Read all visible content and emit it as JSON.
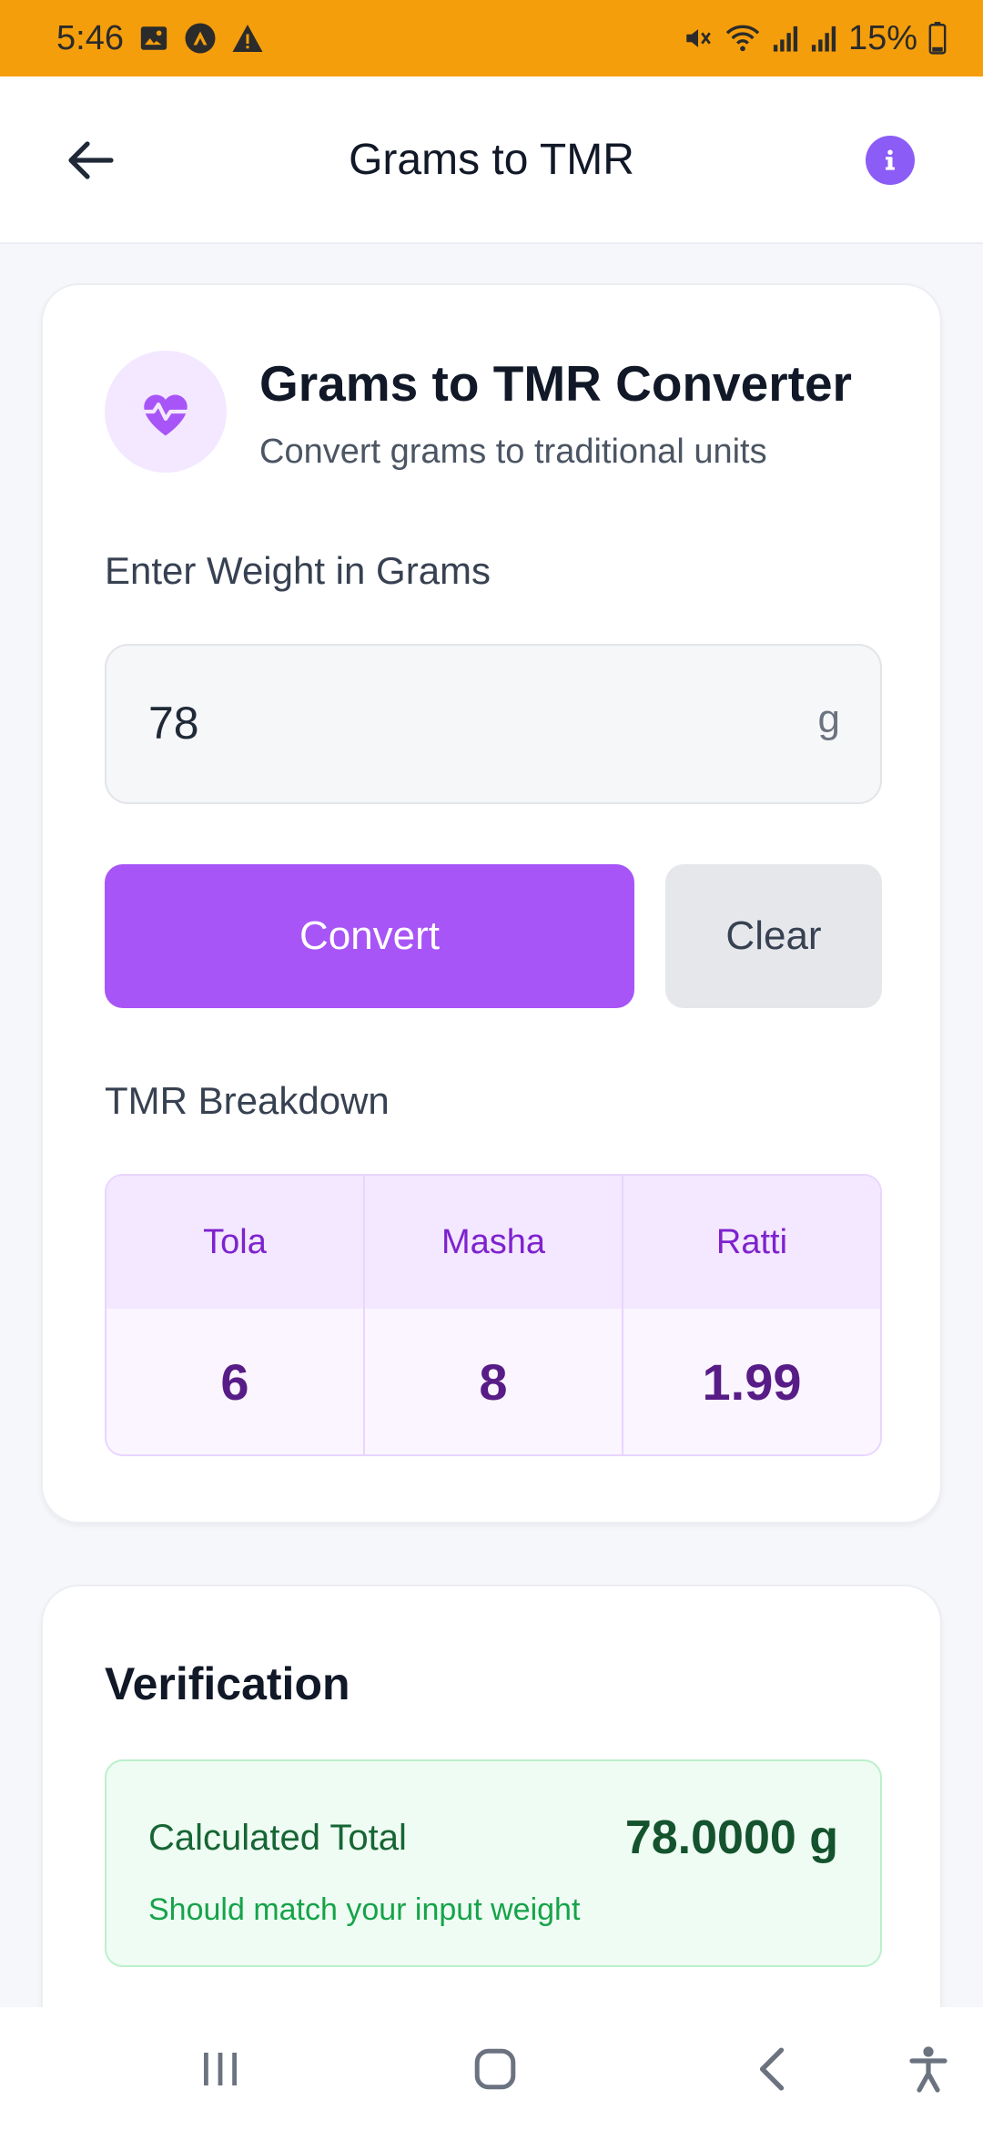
{
  "status_bar": {
    "time": "5:46",
    "battery": "15%",
    "icons_left": [
      "image-icon",
      "app-badge-icon",
      "warning-icon"
    ],
    "icons_right": [
      "mute-icon",
      "wifi-icon",
      "signal-icon",
      "signal-icon",
      "battery-icon"
    ]
  },
  "app_bar": {
    "title": "Grams to TMR"
  },
  "converter": {
    "title": "Grams to TMR Converter",
    "subtitle": "Convert grams to traditional units",
    "input_label": "Enter Weight in Grams",
    "input_value": "78",
    "input_unit": "g",
    "convert_label": "Convert",
    "clear_label": "Clear",
    "breakdown_label": "TMR Breakdown",
    "breakdown": [
      {
        "unit": "Tola",
        "value": "6"
      },
      {
        "unit": "Masha",
        "value": "8"
      },
      {
        "unit": "Ratti",
        "value": "1.99"
      }
    ]
  },
  "verification": {
    "title": "Verification",
    "total_label": "Calculated Total",
    "total_value": "78.0000 g",
    "hint": "Should match your input weight"
  },
  "colors": {
    "status_bar": "#f59e0b",
    "accent": "#a855f7",
    "success_bg": "#effcf3"
  }
}
